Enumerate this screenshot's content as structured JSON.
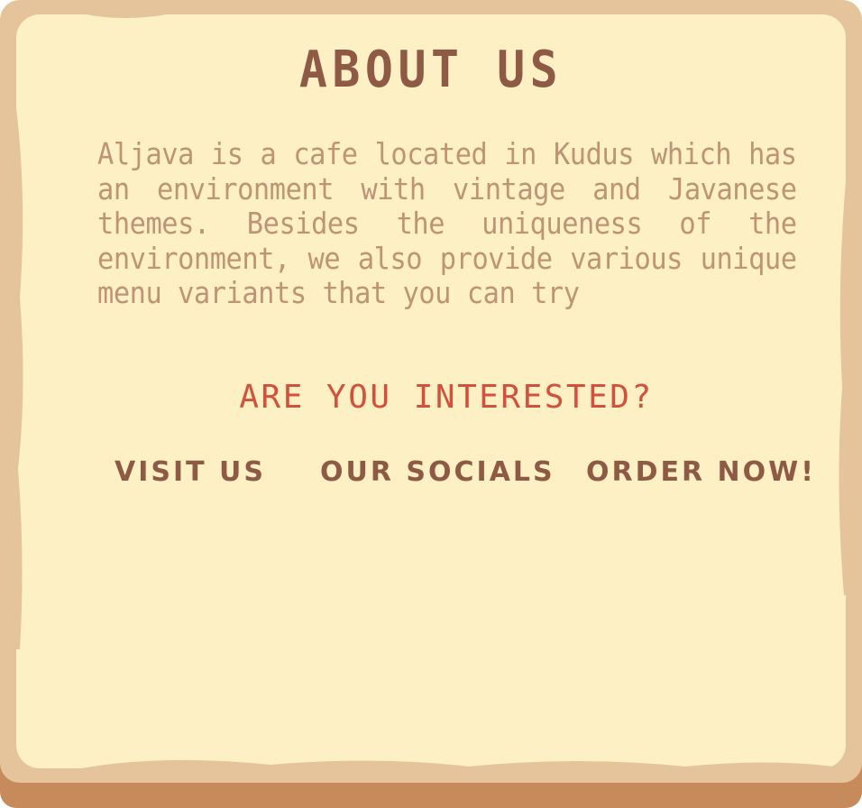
{
  "about": {
    "title": "ABOUT US",
    "description": "Aljava is a cafe located in Kudus which has an environment with vintage and Javanese themes. Besides the uniqueness of the environment, we also provide various unique menu variants that you can try"
  },
  "cta": {
    "question": "ARE YOU INTERESTED?"
  },
  "nav": {
    "visit_label": "VISIT US",
    "socials_label": "OUR SOCIALS",
    "order_label": "ORDER NOW!"
  },
  "colors": {
    "frame": "#e5c49c",
    "frame_shadow": "#c68a5b",
    "paper": "#fdf0c5",
    "heading": "#8e5a45",
    "body_text": "#be9376",
    "accent": "#d2513d"
  }
}
